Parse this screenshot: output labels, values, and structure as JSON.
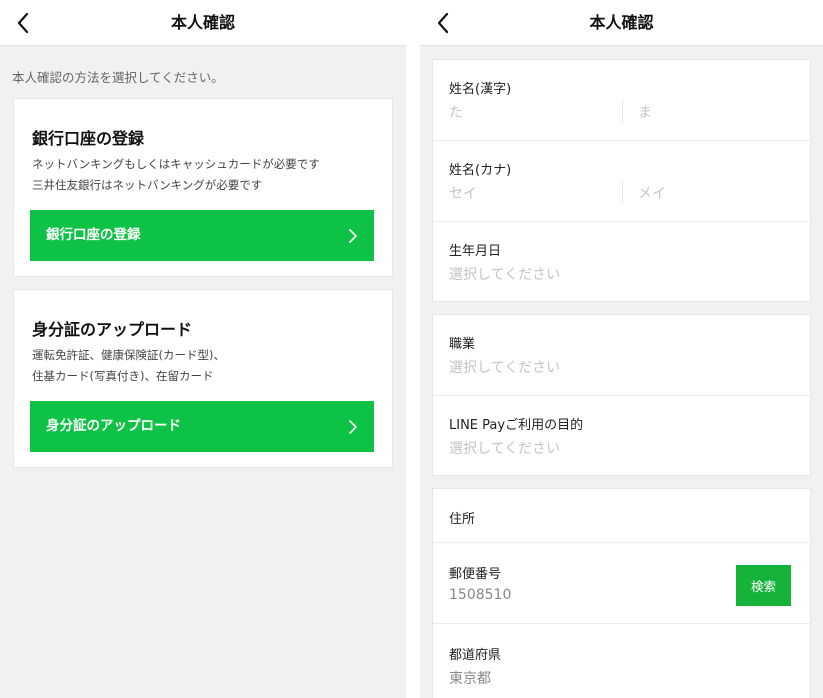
{
  "left_screen": {
    "title": "本人確認",
    "intro": "本人確認の方法を選択してください。",
    "bank_card": {
      "title": "銀行口座の登録",
      "desc_line1": "ネットバンキングもしくはキャッシュカードが必要です",
      "desc_line2": "三井住友銀行はネットバンキングが必要です",
      "button_label": "銀行口座の登録"
    },
    "id_card": {
      "title": "身分証のアップロード",
      "desc_line1": "運転免許証、健康保険証(カード型)、",
      "desc_line2": "住基カード(写真付き)、在留カード",
      "button_label": "身分証のアップロード"
    }
  },
  "right_screen": {
    "title": "本人確認",
    "name_kanji": {
      "label": "姓名(漢字)",
      "last_placeholder": "た",
      "first_placeholder": "ま"
    },
    "name_kana": {
      "label": "姓名(カナ)",
      "last_placeholder": "セイ",
      "first_placeholder": "メイ"
    },
    "birthdate": {
      "label": "生年月日",
      "placeholder": "選択してください"
    },
    "occupation": {
      "label": "職業",
      "placeholder": "選択してください"
    },
    "purpose": {
      "label": "LINE Payご利用の目的",
      "placeholder": "選択してください"
    },
    "address": {
      "header": "住所",
      "postal_label": "郵便番号",
      "postal_value": "1508510",
      "search_label": "検索",
      "prefecture_label": "都道府県",
      "prefecture_value": "東京都"
    }
  },
  "colors": {
    "accent_green": "#0ec245",
    "search_green": "#16b33a",
    "background": "#f1f1f1"
  },
  "icons": {
    "back": "chevron-left-icon",
    "button_arrow": "chevron-right-icon"
  }
}
